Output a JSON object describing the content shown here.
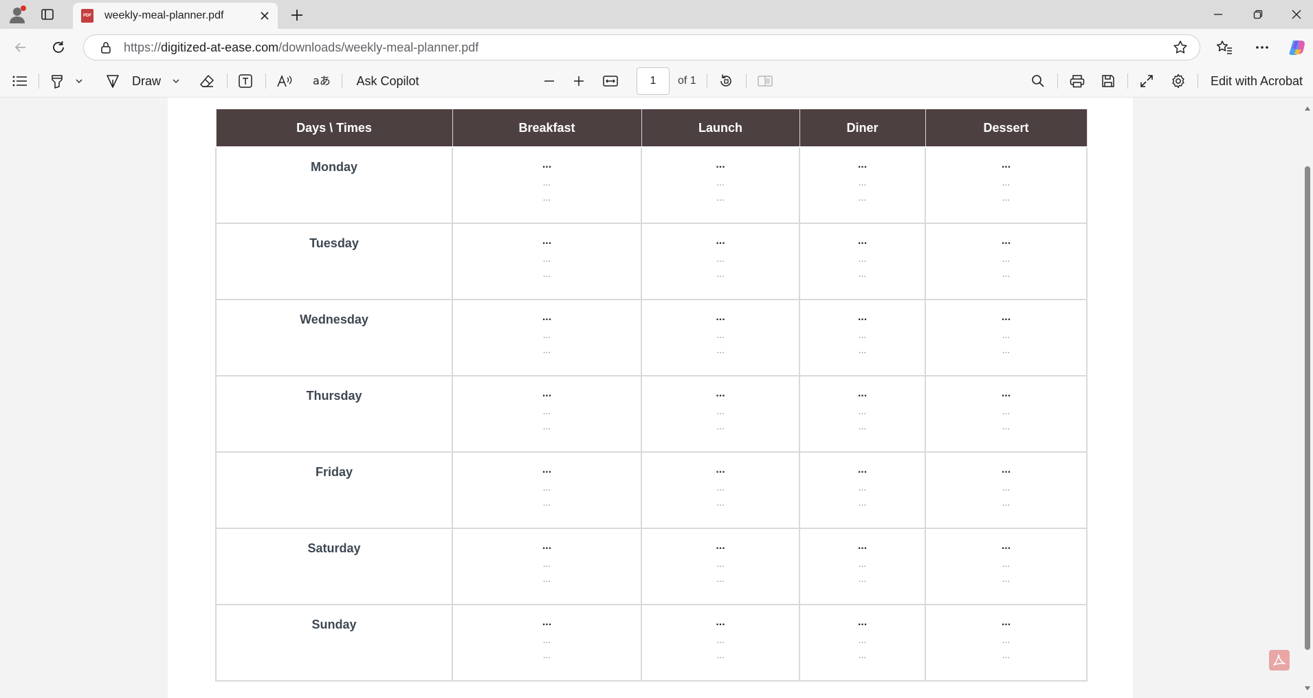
{
  "tab": {
    "title": "weekly-meal-planner.pdf",
    "favicon": "PDF"
  },
  "address": {
    "scheme": "https://",
    "host": "digitized-at-ease.com",
    "path": "/downloads/weekly-meal-planner.pdf"
  },
  "toolbar": {
    "draw_label": "Draw",
    "ask_copilot_label": "Ask Copilot",
    "page_current": "1",
    "page_total": "of 1",
    "edit_acrobat_label": "Edit with Acrobat"
  },
  "planner": {
    "headers": [
      "Days \\ Times",
      "Breakfast",
      "Launch",
      "Diner",
      "Dessert"
    ],
    "days": [
      "Monday",
      "Tuesday",
      "Wednesday",
      "Thursday",
      "Friday",
      "Saturday",
      "Sunday"
    ],
    "cell_main": "...",
    "cell_sub": "..."
  },
  "colors": {
    "header_bg": "#4d4041",
    "header_text": "#ffffff",
    "day_text": "#3d4752"
  }
}
